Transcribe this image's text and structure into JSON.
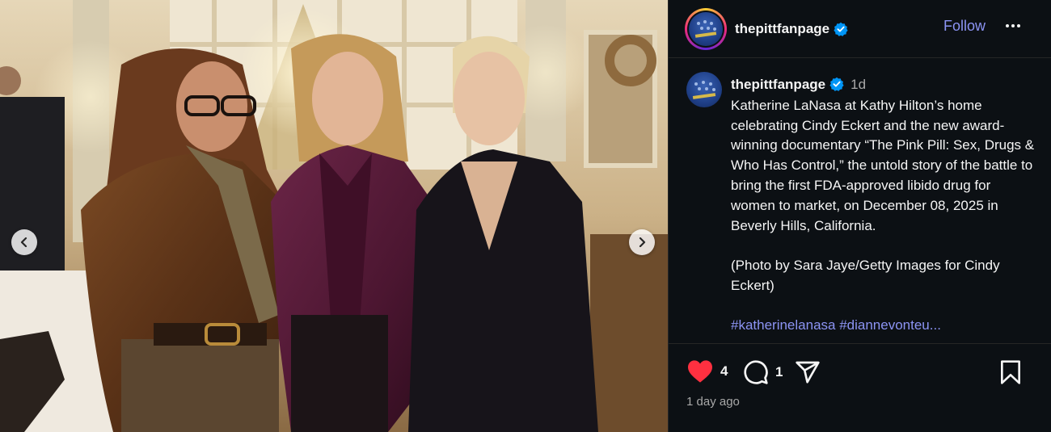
{
  "post": {
    "username": "thepittfanpage",
    "follow_label": "Follow",
    "more_icon": "more-horizontal-icon"
  },
  "caption": {
    "username": "thepittfanpage",
    "time": "1d",
    "body": "Katherine LaNasa at Kathy Hilton’s home celebrating Cindy Eckert and the new award-winning documentary “The Pink Pill: Sex, Drugs & Who Has Control,” the untold story of the battle to bring the first FDA-approved libido drug for women to market, on December 08, 2025 in Beverly Hills, California.\n\n(Photo by Sara Jaye/Getty Images for Cindy Eckert)",
    "hashtags": "#katherinelanasa #diannevonteu..."
  },
  "actions": {
    "likes": "4",
    "comments": "1",
    "timestamp": "1 day ago"
  },
  "colors": {
    "background": "#0c1014",
    "link": "#8c94f4",
    "like_heart": "#ff3040",
    "verified": "#0095f6"
  },
  "icons": {
    "like": "heart-filled-icon",
    "comment": "comment-bubble-icon",
    "share": "paper-plane-icon",
    "save": "bookmark-icon",
    "prev": "chevron-left-icon",
    "next": "chevron-right-icon"
  }
}
